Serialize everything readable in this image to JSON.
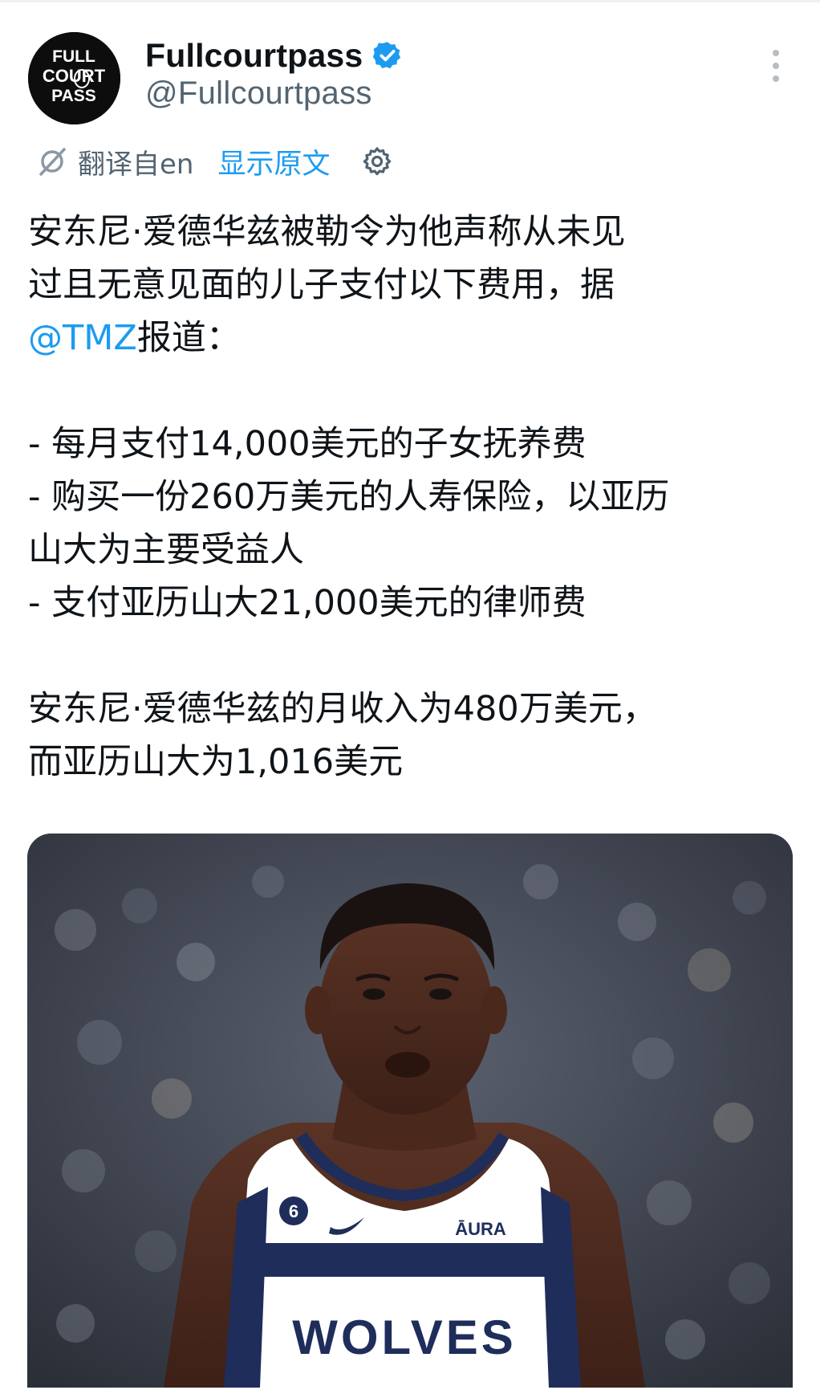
{
  "author": {
    "display_name": "Fullcourtpass",
    "handle": "@Fullcourtpass",
    "avatar_text": [
      "FULL",
      "COURT",
      "PASS"
    ],
    "verified": true
  },
  "translation": {
    "translated_from": "翻译自en",
    "show_original": "显示原文"
  },
  "tweet": {
    "intro_lines": [
      "安东尼·爱德华兹被勒令为他声称从未见",
      "过且无意见面的儿子支付以下费用，据"
    ],
    "mention": "@TMZ",
    "mention_suffix": "报道：",
    "items": [
      "- 每月支付14,000美元的子女抚养费",
      "- 购买一份260万美元的人寿保险，以亚历",
      "山大为主要受益人",
      "- 支付亚历山大21,000美元的律师费"
    ],
    "closing_lines": [
      "安东尼·爱德华兹的月收入为480万美元，",
      "而亚历山大为1,016美元"
    ]
  },
  "media": {
    "jersey_number": "6",
    "jersey_sponsor": "ĀURA",
    "jersey_team": "WOLVES"
  },
  "colors": {
    "link": "#1d9bf0",
    "text": "#0f1419",
    "secondary": "#536471",
    "jersey_navy": "#1f2d5a"
  },
  "icons": [
    "verified-badge-icon",
    "more-options-icon",
    "translate-icon",
    "settings-gear-icon"
  ]
}
